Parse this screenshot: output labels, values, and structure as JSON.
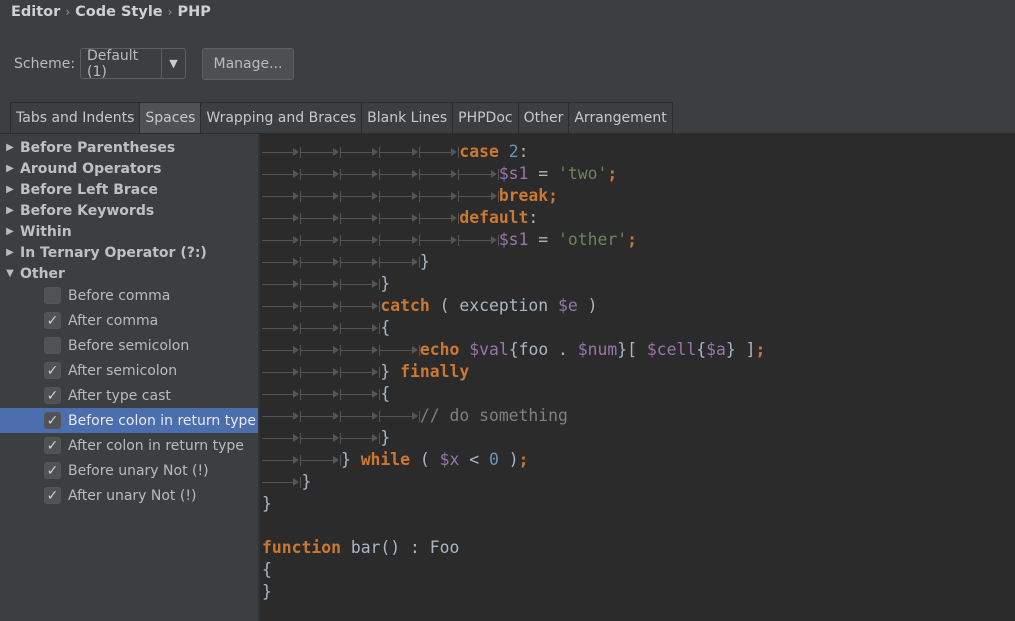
{
  "breadcrumb": [
    "Editor",
    "Code Style",
    "PHP"
  ],
  "scheme": {
    "label": "Scheme:",
    "value": "Default (1)",
    "manage_label": "Manage..."
  },
  "tabs": [
    {
      "label": "Tabs and Indents",
      "active": false
    },
    {
      "label": "Spaces",
      "active": true
    },
    {
      "label": "Wrapping and Braces",
      "active": false
    },
    {
      "label": "Blank Lines",
      "active": false
    },
    {
      "label": "PHPDoc",
      "active": false
    },
    {
      "label": "Other",
      "active": false
    },
    {
      "label": "Arrangement",
      "active": false
    }
  ],
  "groups": [
    {
      "label": "Before Parentheses",
      "expanded": false
    },
    {
      "label": "Around Operators",
      "expanded": false
    },
    {
      "label": "Before Left Brace",
      "expanded": false
    },
    {
      "label": "Before Keywords",
      "expanded": false
    },
    {
      "label": "Within",
      "expanded": false
    },
    {
      "label": "In Ternary Operator (?:)",
      "expanded": false
    },
    {
      "label": "Other",
      "expanded": true
    }
  ],
  "options": [
    {
      "label": "Before comma",
      "checked": false,
      "selected": false
    },
    {
      "label": "After comma",
      "checked": true,
      "selected": false
    },
    {
      "label": "Before semicolon",
      "checked": false,
      "selected": false
    },
    {
      "label": "After semicolon",
      "checked": true,
      "selected": false
    },
    {
      "label": "After type cast",
      "checked": true,
      "selected": false
    },
    {
      "label": "Before colon in return type",
      "checked": true,
      "selected": true
    },
    {
      "label": "After colon in return type",
      "checked": true,
      "selected": false
    },
    {
      "label": "Before unary Not (!)",
      "checked": true,
      "selected": false
    },
    {
      "label": "After unary Not (!)",
      "checked": true,
      "selected": false
    }
  ],
  "colors": {
    "keyword": "#cc7832",
    "variable": "#9876aa",
    "string": "#6a8759",
    "number": "#6897bb",
    "text": "#a9b7c6",
    "comment": "#808080",
    "selection": "#4b6eaf",
    "editor_bg": "#2b2b2b",
    "panel_bg": "#3c3f41"
  },
  "code": [
    {
      "indent": 5,
      "tokens": [
        [
          "kw",
          "case"
        ],
        [
          "pl",
          " "
        ],
        [
          "num",
          "2"
        ],
        [
          "pl",
          ":"
        ]
      ]
    },
    {
      "indent": 6,
      "tokens": [
        [
          "var",
          "$s1"
        ],
        [
          "pl",
          " = "
        ],
        [
          "str",
          "'two'"
        ],
        [
          "kw",
          ";"
        ]
      ]
    },
    {
      "indent": 6,
      "tokens": [
        [
          "kw",
          "break;"
        ]
      ]
    },
    {
      "indent": 5,
      "tokens": [
        [
          "kw",
          "default"
        ],
        [
          "pl",
          ":"
        ]
      ]
    },
    {
      "indent": 6,
      "tokens": [
        [
          "var",
          "$s1"
        ],
        [
          "pl",
          " = "
        ],
        [
          "str",
          "'other'"
        ],
        [
          "kw",
          ";"
        ]
      ]
    },
    {
      "indent": 4,
      "tokens": [
        [
          "pl",
          "}"
        ]
      ]
    },
    {
      "indent": 3,
      "tokens": [
        [
          "pl",
          "}"
        ]
      ]
    },
    {
      "indent": 3,
      "tokens": [
        [
          "kw",
          "catch"
        ],
        [
          "pl",
          " ( exception "
        ],
        [
          "var",
          "$e"
        ],
        [
          "pl",
          " )"
        ]
      ]
    },
    {
      "indent": 3,
      "tokens": [
        [
          "pl",
          "{"
        ]
      ]
    },
    {
      "indent": 4,
      "tokens": [
        [
          "kw",
          "echo"
        ],
        [
          "pl",
          " "
        ],
        [
          "var",
          "$val"
        ],
        [
          "pl",
          "{foo . "
        ],
        [
          "var",
          "$num"
        ],
        [
          "pl",
          "}[ "
        ],
        [
          "var",
          "$cell"
        ],
        [
          "pl",
          "{"
        ],
        [
          "var",
          "$a"
        ],
        [
          "pl",
          "} ]"
        ],
        [
          "kw",
          ";"
        ]
      ]
    },
    {
      "indent": 3,
      "tokens": [
        [
          "pl",
          "} "
        ],
        [
          "kw",
          "finally"
        ]
      ]
    },
    {
      "indent": 3,
      "tokens": [
        [
          "pl",
          "{"
        ]
      ]
    },
    {
      "indent": 4,
      "tokens": [
        [
          "cm",
          "// do something"
        ]
      ]
    },
    {
      "indent": 3,
      "tokens": [
        [
          "pl",
          "}"
        ]
      ]
    },
    {
      "indent": 2,
      "tokens": [
        [
          "pl",
          "} "
        ],
        [
          "kw",
          "while"
        ],
        [
          "pl",
          " ( "
        ],
        [
          "var",
          "$x"
        ],
        [
          "pl",
          " < "
        ],
        [
          "num",
          "0"
        ],
        [
          "pl",
          " )"
        ],
        [
          "kw",
          ";"
        ]
      ]
    },
    {
      "indent": 1,
      "tokens": [
        [
          "pl",
          "}"
        ]
      ]
    },
    {
      "indent": 0,
      "tokens": [
        [
          "pl",
          "}"
        ]
      ]
    },
    {
      "indent": 0,
      "tokens": []
    },
    {
      "indent": 0,
      "tokens": [
        [
          "kw",
          "function"
        ],
        [
          "pl",
          " bar() : Foo"
        ]
      ]
    },
    {
      "indent": 0,
      "tokens": [
        [
          "pl",
          "{"
        ]
      ]
    },
    {
      "indent": 0,
      "tokens": [
        [
          "pl",
          "}"
        ]
      ]
    }
  ]
}
